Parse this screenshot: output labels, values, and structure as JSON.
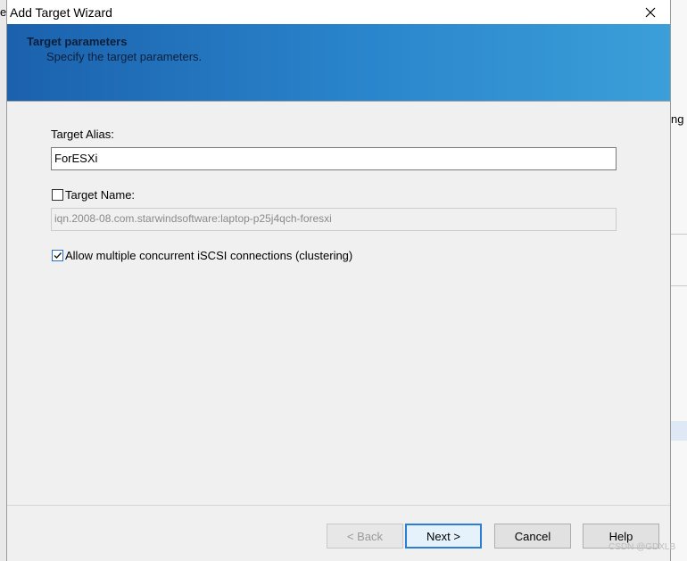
{
  "window": {
    "title": "Add Target Wizard"
  },
  "header": {
    "title": "Target parameters",
    "subtitle": "Specify the target parameters."
  },
  "form": {
    "alias_label": "Target Alias:",
    "alias_value": "ForESXi",
    "name_checkbox_label": "Target Name:",
    "name_checked": false,
    "name_value": "iqn.2008-08.com.starwindsoftware:laptop-p25j4qch-foresxi",
    "clustering_label": "Allow multiple concurrent iSCSI connections (clustering)",
    "clustering_checked": true
  },
  "buttons": {
    "back": "< Back",
    "next": "Next >",
    "cancel": "Cancel",
    "help": "Help"
  },
  "background": {
    "left_fragment": "e",
    "right_fragment": "ng"
  },
  "watermark": "CSDN @GDXLB",
  "icons": {
    "close": "close-icon",
    "check": "checkmark-icon"
  },
  "colors": {
    "header_start": "#1b61ad",
    "header_end": "#3b9fd8",
    "default_button_border": "#2a7fd4"
  }
}
